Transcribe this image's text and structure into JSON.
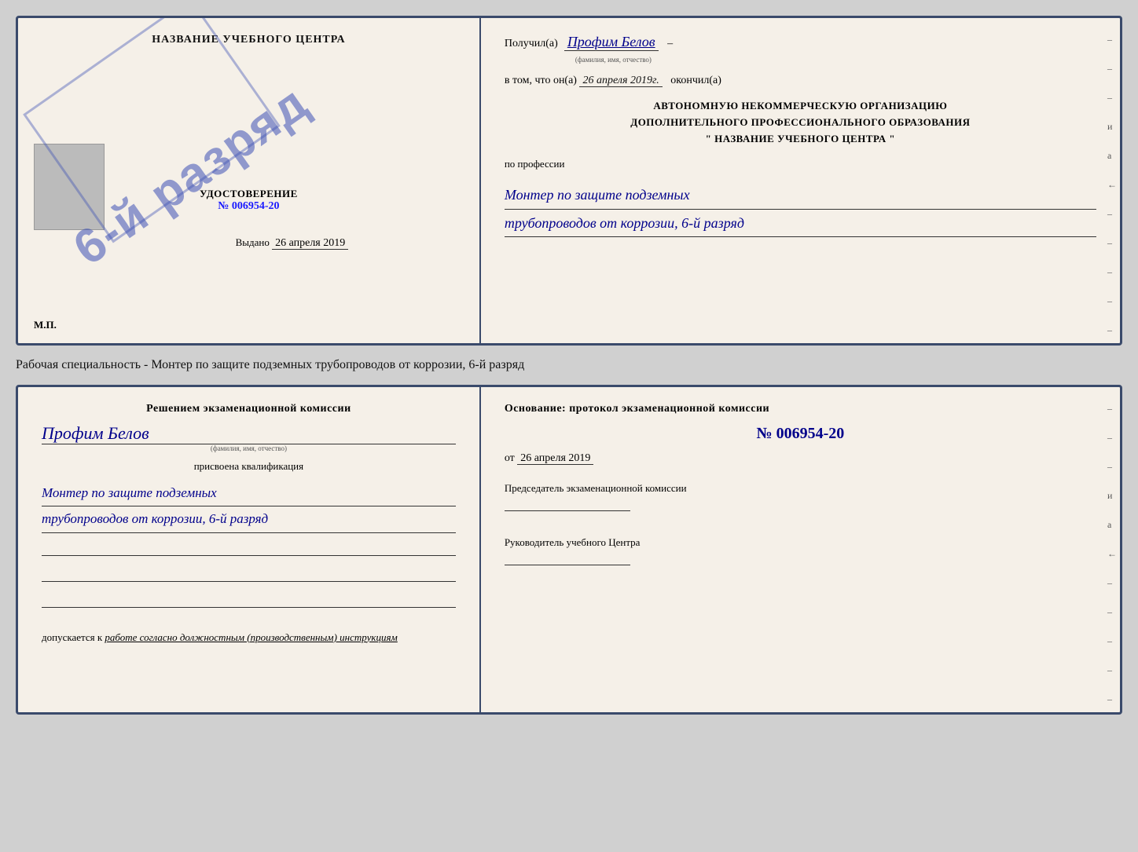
{
  "diploma": {
    "left": {
      "header": "НАЗВАНИЕ УЧЕБНОГО ЦЕНТРА",
      "cert_label": "УДОСТОВЕРЕНИЕ",
      "cert_number": "№ 006954-20",
      "stamp_text": "6-й разряд",
      "issued_label": "Выдано",
      "issued_date": "26 апреля 2019",
      "mp_label": "М.П."
    },
    "right": {
      "received_label": "Получил(а)",
      "recipient_name": "Профим Белов",
      "recipient_sublabel": "(фамилия, имя, отчество)",
      "date_prefix": "в том, что он(а)",
      "date_value": "26 апреля 2019г.",
      "date_suffix": "окончил(а)",
      "org_line1": "АВТОНОМНУЮ НЕКОММЕРЧЕСКУЮ ОРГАНИЗАЦИЮ",
      "org_line2": "ДОПОЛНИТЕЛЬНОГО ПРОФЕССИОНАЛЬНОГО ОБРАЗОВАНИЯ",
      "org_line3": "\"   НАЗВАНИЕ УЧЕБНОГО ЦЕНТРА   \"",
      "profession_prefix": "по профессии",
      "profession_line1": "Монтер по защите подземных",
      "profession_line2": "трубопроводов от коррозии, 6-й разряд"
    }
  },
  "specialty_label": "Рабочая специальность - Монтер по защите подземных трубопроводов от коррозии, 6-й разряд",
  "qualification": {
    "left": {
      "decision_text": "Решением экзаменационной комиссии",
      "person_name": "Профим Белов",
      "person_sublabel": "(фамилия, имя, отчество)",
      "assigned_label": "присвоена квалификация",
      "qual_line1": "Монтер по защите подземных",
      "qual_line2": "трубопроводов от коррозии, 6-й разряд",
      "admitted_prefix": "допускается к",
      "admitted_value": "работе согласно должностным (производственным) инструкциям"
    },
    "right": {
      "basis_text": "Основание: протокол экзаменационной комиссии",
      "protocol_number": "№ 006954-20",
      "date_prefix": "от",
      "date_value": "26 апреля 2019",
      "chairman_label": "Председатель экзаменационной комиссии",
      "director_label": "Руководитель учебного Центра"
    }
  },
  "dashes": [
    "-",
    "-",
    "-",
    "и",
    "а",
    "←",
    "-",
    "-",
    "-",
    "-",
    "-"
  ]
}
